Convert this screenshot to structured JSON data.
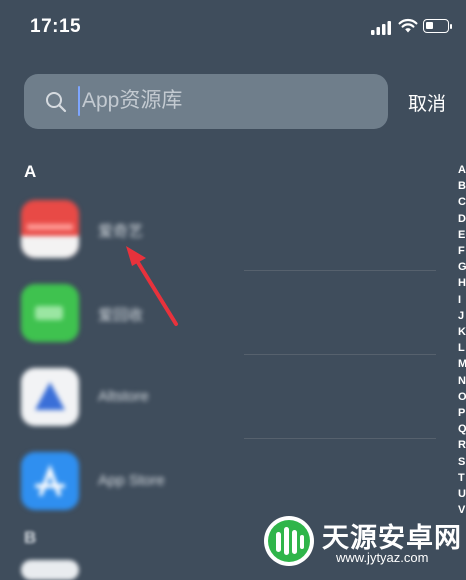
{
  "status_bar": {
    "time": "17:15"
  },
  "search": {
    "placeholder": "App资源库",
    "cancel_label": "取消"
  },
  "sections": [
    {
      "letter": "A",
      "apps": [
        {
          "name": "爱奇艺",
          "icon": "red-app-icon"
        },
        {
          "name": "爱回收",
          "icon": "green-app-icon"
        },
        {
          "name": "Altstore",
          "icon": "white-triangle-app-icon"
        },
        {
          "name": "App Store",
          "icon": "app-store-icon"
        }
      ]
    },
    {
      "letter": "B"
    }
  ],
  "index_letters": [
    "A",
    "B",
    "C",
    "D",
    "E",
    "F",
    "G",
    "H",
    "I",
    "J",
    "K",
    "L",
    "M",
    "N",
    "O",
    "P",
    "Q",
    "R",
    "S",
    "T",
    "U",
    "V"
  ],
  "watermark": {
    "title": "天源安卓网",
    "url": "www.jytyaz.com"
  },
  "colors": {
    "background": "#3f4d5c",
    "search_field": "#6f7e8b",
    "arrow": "#e8323c",
    "watermark_green": "#2fb54a"
  }
}
